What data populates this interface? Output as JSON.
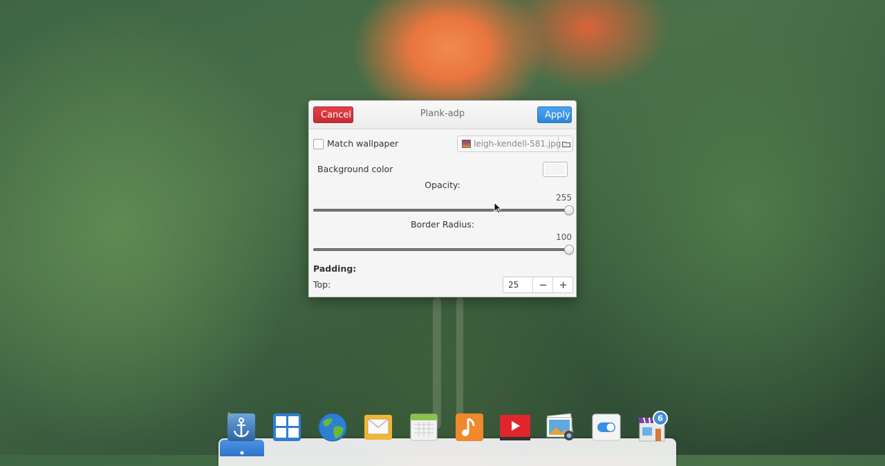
{
  "dialog": {
    "title": "Plank-adp",
    "cancel_label": "Cancel",
    "apply_label": "Apply",
    "match_wallpaper_label": "Match wallpaper",
    "match_wallpaper_checked": false,
    "wallpaper_file": "leigh-kendell-581.jpg",
    "background_color_label": "Background color",
    "background_color_value": "#f4f4f4",
    "opacity": {
      "label": "Opacity:",
      "value": "255",
      "fraction": 1.0
    },
    "border_radius": {
      "label": "Border Radius:",
      "value": "100",
      "fraction": 1.0
    },
    "padding": {
      "label": "Padding:",
      "top_label": "Top:",
      "top_value": "25",
      "minus": "−",
      "plus": "+"
    }
  },
  "dock": {
    "items": [
      {
        "name": "plank-anchor-icon"
      },
      {
        "name": "multitasking-view-icon"
      },
      {
        "name": "web-browser-icon"
      },
      {
        "name": "mail-icon"
      },
      {
        "name": "calendar-icon"
      },
      {
        "name": "music-icon"
      },
      {
        "name": "videos-icon"
      },
      {
        "name": "photos-icon"
      },
      {
        "name": "system-settings-icon"
      },
      {
        "name": "app-center-icon"
      }
    ],
    "badge_count": "6"
  },
  "colors": {
    "cancel": "#d3343c",
    "apply": "#3b95e3",
    "dock_active": "#3a85d6"
  }
}
